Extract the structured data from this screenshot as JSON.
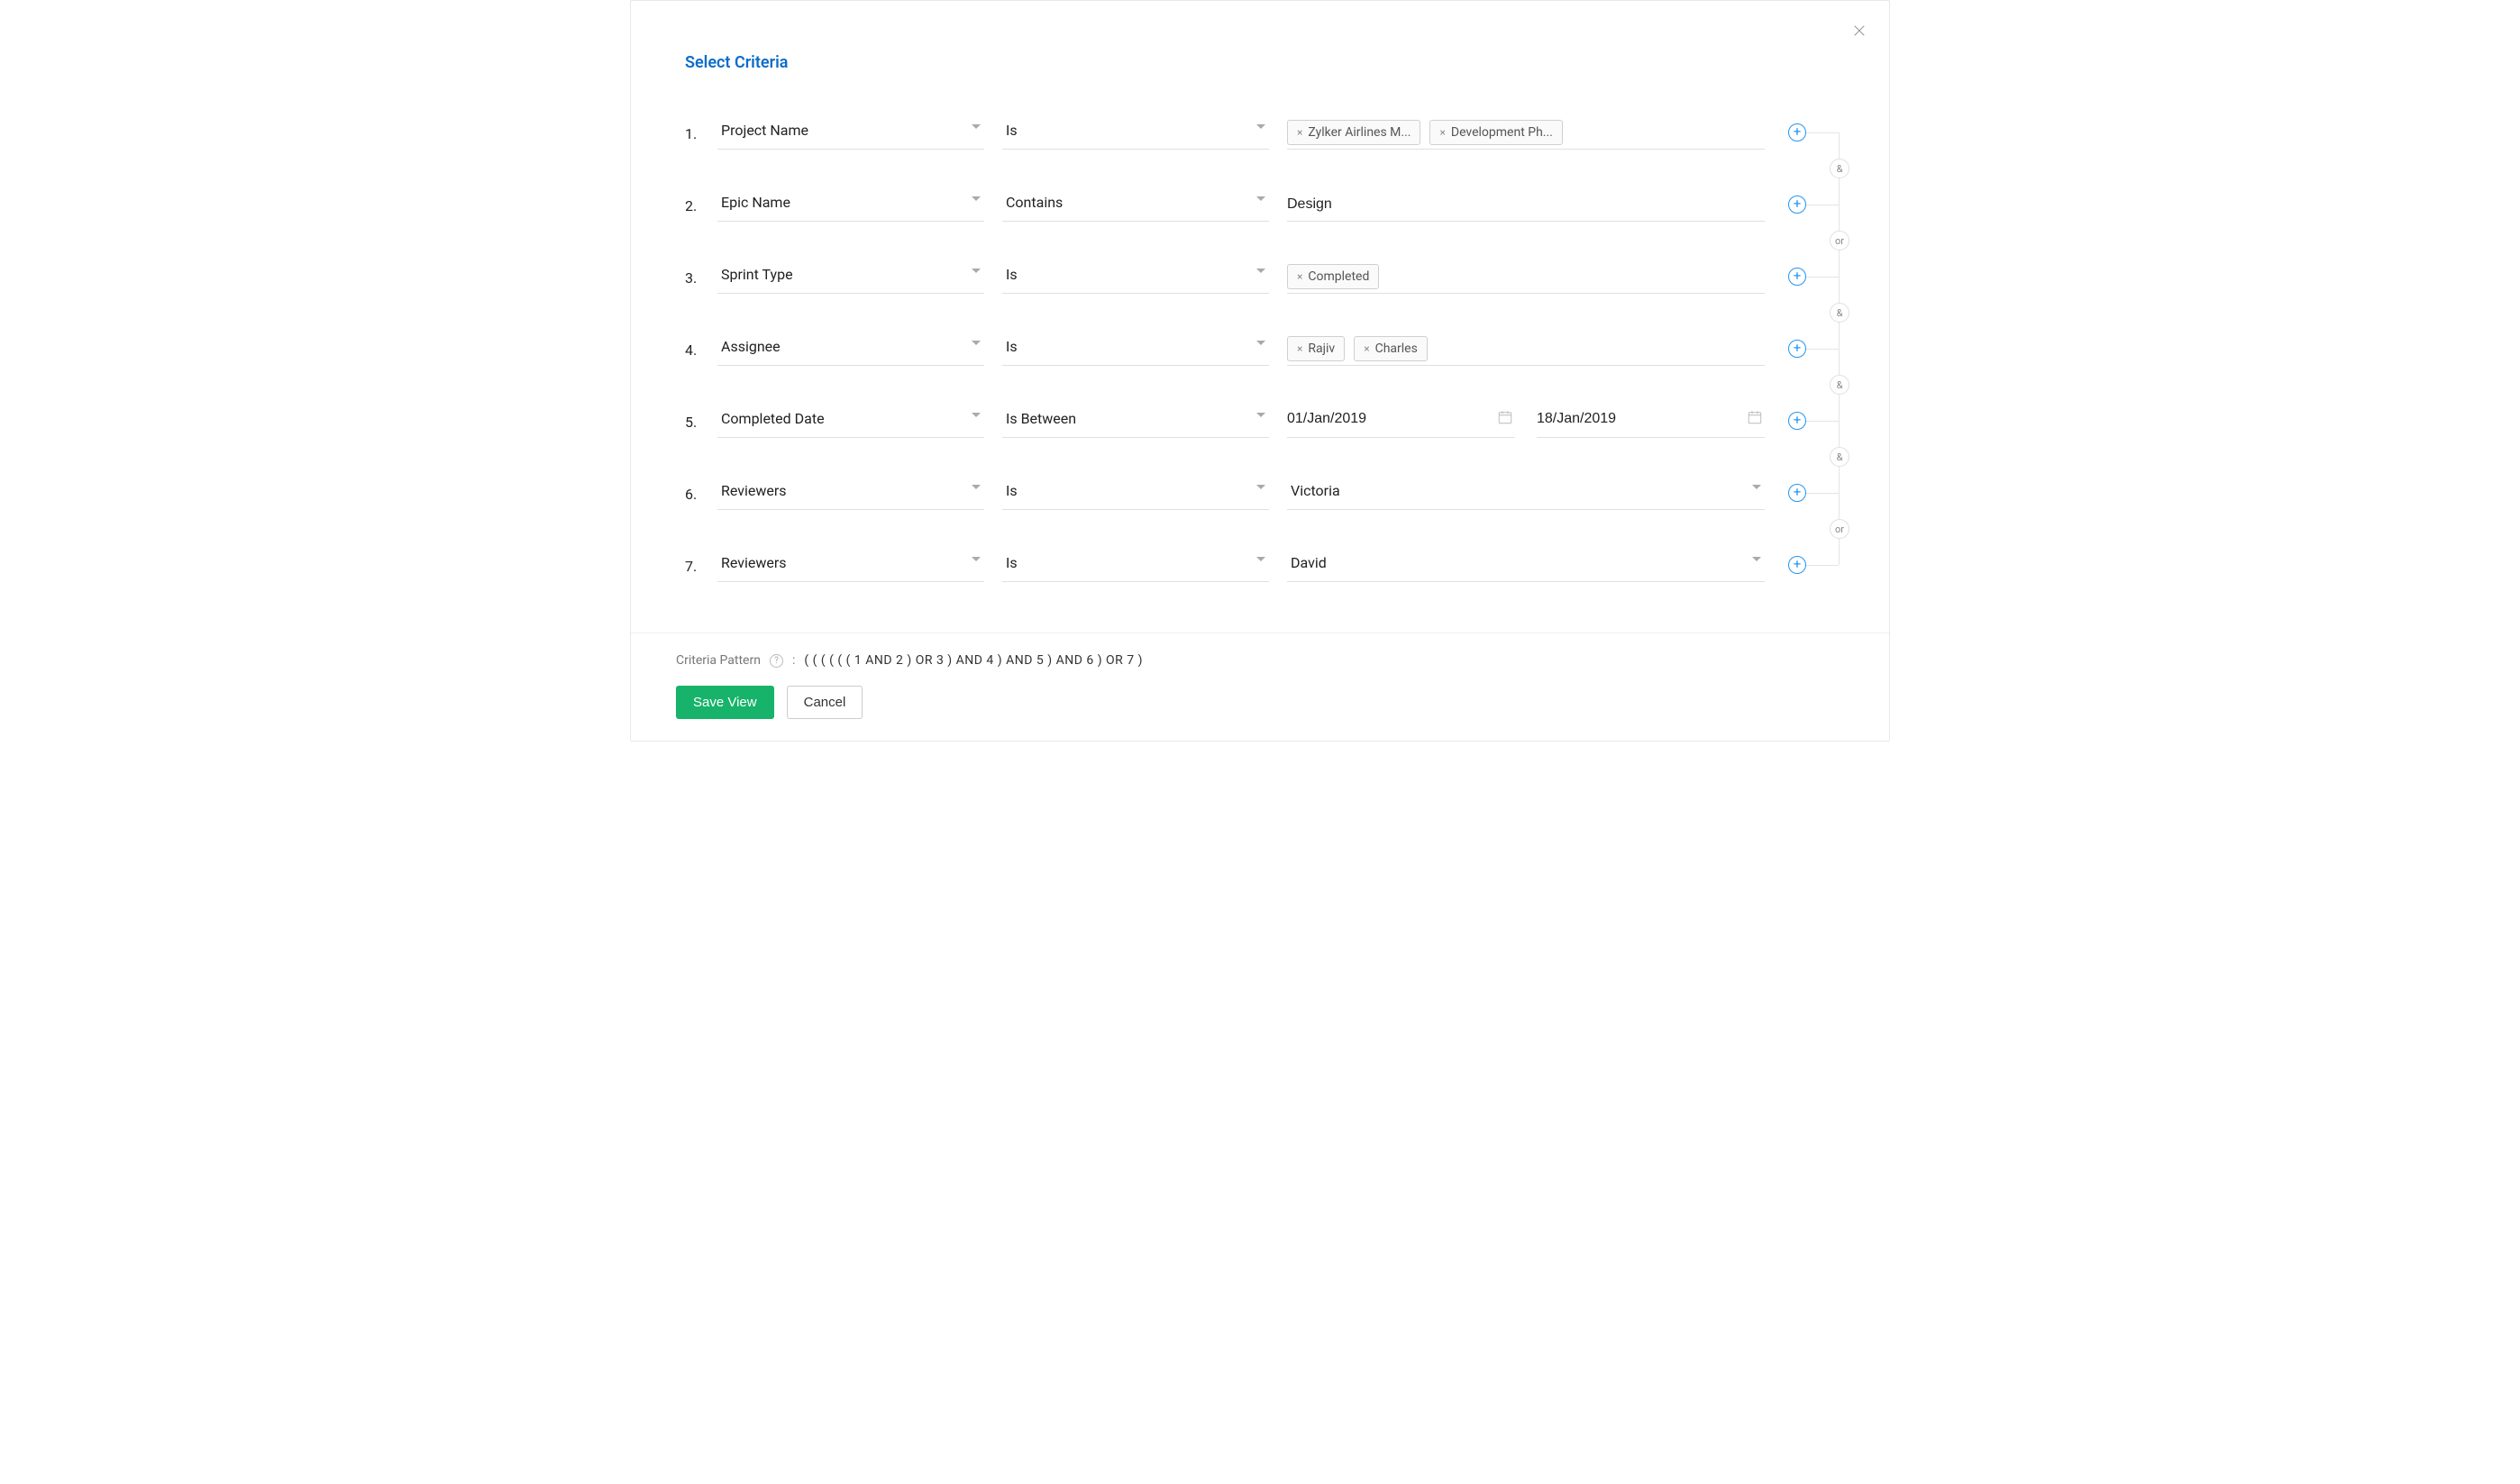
{
  "title": "Select Criteria",
  "rows": [
    {
      "index": "1.",
      "field": "Project Name",
      "operator": "Is",
      "valueType": "chips",
      "chips": [
        "Zylker Airlines M...",
        "Development Ph..."
      ]
    },
    {
      "index": "2.",
      "field": "Epic Name",
      "operator": "Contains",
      "valueType": "text",
      "textValue": "Design"
    },
    {
      "index": "3.",
      "field": "Sprint Type",
      "operator": "Is",
      "valueType": "chips",
      "chips": [
        "Completed"
      ]
    },
    {
      "index": "4.",
      "field": "Assignee",
      "operator": "Is",
      "valueType": "chips",
      "chips": [
        "Rajiv",
        "Charles"
      ]
    },
    {
      "index": "5.",
      "field": "Completed Date",
      "operator": "Is Between",
      "valueType": "daterange",
      "dateFrom": "01/Jan/2019",
      "dateTo": "18/Jan/2019"
    },
    {
      "index": "6.",
      "field": "Reviewers",
      "operator": "Is",
      "valueType": "select",
      "selectValue": "Victoria"
    },
    {
      "index": "7.",
      "field": "Reviewers",
      "operator": "Is",
      "valueType": "select",
      "selectValue": "David"
    }
  ],
  "connectors": [
    "&",
    "or",
    "&",
    "&",
    "&",
    "or"
  ],
  "footer": {
    "patternLabel": "Criteria Pattern",
    "colon": ":",
    "patternExpr": "( ( ( ( ( ( 1 AND 2 ) OR 3 ) AND 4 ) AND 5 ) AND 6 ) OR 7 )",
    "save": "Save View",
    "cancel": "Cancel"
  }
}
